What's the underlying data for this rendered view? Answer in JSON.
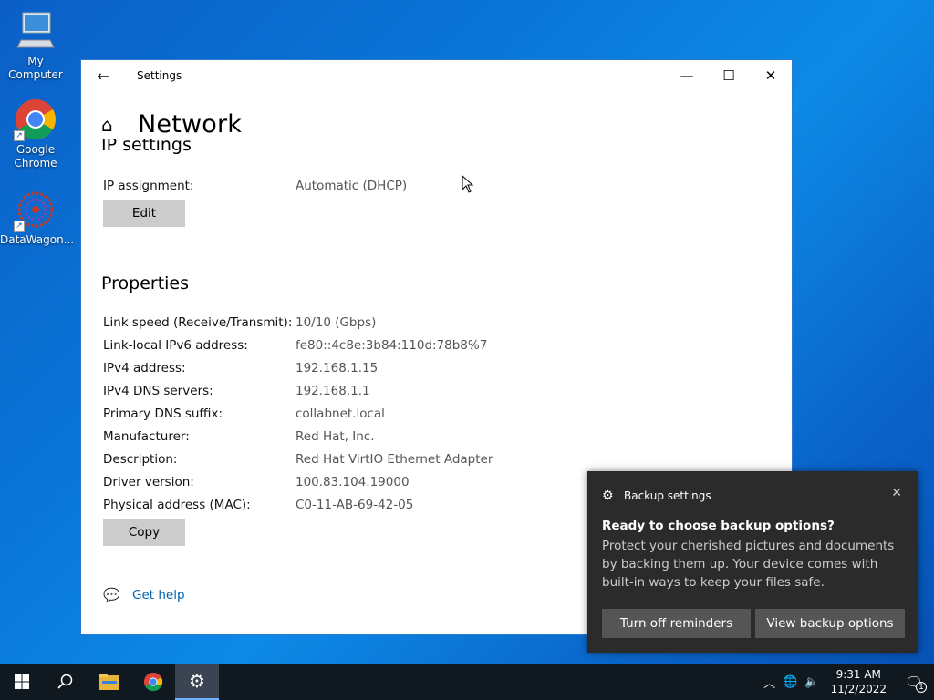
{
  "desktop": {
    "icons": [
      {
        "label": "My Computer"
      },
      {
        "label": "Google Chrome"
      },
      {
        "label": "DataWagon..."
      }
    ]
  },
  "window": {
    "title": "Settings",
    "page_title": "Network",
    "ip_section": "IP settings",
    "ip_assignment": {
      "label": "IP assignment:",
      "value": "Automatic (DHCP)"
    },
    "edit_button": "Edit",
    "properties_title": "Properties",
    "properties": [
      {
        "label": "Link speed (Receive/Transmit):",
        "value": "10/10 (Gbps)"
      },
      {
        "label": "Link-local IPv6 address:",
        "value": "fe80::4c8e:3b84:110d:78b8%7"
      },
      {
        "label": "IPv4 address:",
        "value": "192.168.1.15"
      },
      {
        "label": "IPv4 DNS servers:",
        "value": "192.168.1.1"
      },
      {
        "label": "Primary DNS suffix:",
        "value": "collabnet.local"
      },
      {
        "label": "Manufacturer:",
        "value": "Red Hat, Inc."
      },
      {
        "label": "Description:",
        "value": "Red Hat VirtIO Ethernet Adapter"
      },
      {
        "label": "Driver version:",
        "value": "100.83.104.19000"
      },
      {
        "label": "Physical address (MAC):",
        "value": "C0-11-AB-69-42-05"
      }
    ],
    "copy_button": "Copy",
    "get_help": "Get help"
  },
  "toast": {
    "app": "Backup settings",
    "title": "Ready to choose backup options?",
    "body": "Protect your cherished pictures and documents by backing them up. Your device comes with built-in ways to keep your files safe.",
    "btn_off": "Turn off reminders",
    "btn_view": "View backup options"
  },
  "taskbar": {
    "time": "9:31 AM",
    "date": "11/2/2022",
    "notification_count": "1"
  },
  "colors": {
    "accent": "#0063b1",
    "toast_bg": "#2b2b2b",
    "taskbar_bg": "#101820"
  }
}
